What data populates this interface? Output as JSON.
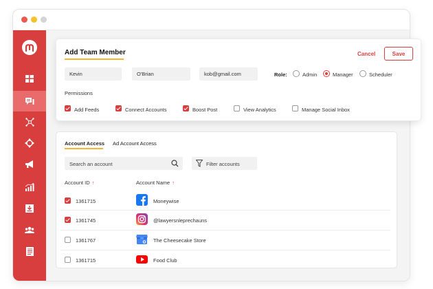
{
  "form": {
    "title": "Add Team Member",
    "cancel_label": "Cancel",
    "save_label": "Save",
    "first_name": "Kevin",
    "last_name": "O'Brian",
    "email": "kob@gmail.com",
    "role_label": "Role:",
    "roles": [
      {
        "label": "Admin",
        "selected": false
      },
      {
        "label": "Manager",
        "selected": true
      },
      {
        "label": "Scheduler",
        "selected": false
      }
    ],
    "permissions_title": "Permissions",
    "permissions": [
      {
        "label": "Add Feeds",
        "checked": true
      },
      {
        "label": "Connect Accounts",
        "checked": true
      },
      {
        "label": "Boost Post",
        "checked": true
      },
      {
        "label": "View Analytics",
        "checked": false
      },
      {
        "label": "Manage Social Inbox",
        "checked": false
      }
    ]
  },
  "access": {
    "tabs": [
      {
        "label": "Account Access",
        "active": true
      },
      {
        "label": "Ad Account Access",
        "active": false
      }
    ],
    "search_placeholder": "Search an account",
    "filter_placeholder": "Filter accounts",
    "columns": {
      "id": "Account ID",
      "name": "Account Name",
      "sort_glyph": "↑"
    },
    "rows": [
      {
        "id": "1361715",
        "name": "Moneywise",
        "checked": true,
        "network": "facebook-icon"
      },
      {
        "id": "1361745",
        "name": "@lawyersnleprechauns",
        "checked": true,
        "network": "instagram-icon"
      },
      {
        "id": "1361767",
        "name": "The Cheesecake Store",
        "checked": false,
        "network": "google-my-business-icon"
      },
      {
        "id": "1361715",
        "name": "Food Club",
        "checked": false,
        "network": "youtube-icon"
      }
    ]
  },
  "colors": {
    "accent": "#d93e3e",
    "sidebar_active": "#e96b6b",
    "underline": "#f2b632"
  },
  "sidebar": {
    "items": [
      "logo",
      "dashboard-icon",
      "publish-icon",
      "network-icon",
      "move-icon",
      "megaphone-icon",
      "analytics-icon",
      "download-icon",
      "team-icon",
      "reports-icon"
    ],
    "active_index": 2
  }
}
